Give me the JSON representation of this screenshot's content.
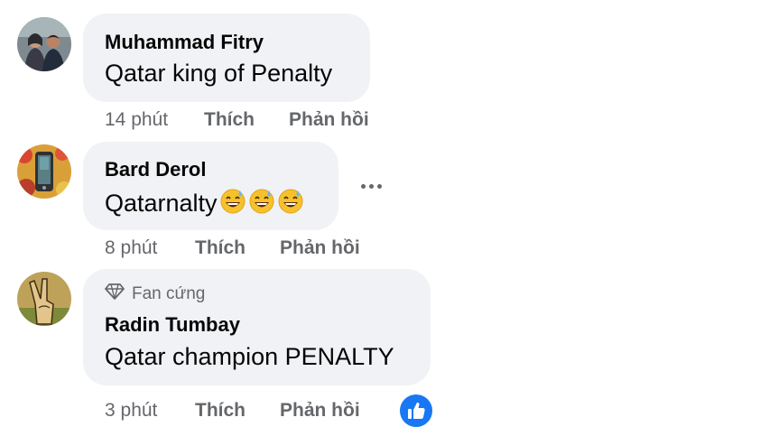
{
  "colors": {
    "bubble": "#f0f2f5",
    "meta": "#65676b",
    "like_blue": "#1877f2"
  },
  "comments": [
    {
      "author": "Muhammad Fitry",
      "text": "Qatar king of Penalty",
      "time": "14 phút",
      "like_label": "Thích",
      "reply_label": "Phản hồi"
    },
    {
      "author": "Bard Derol",
      "text": "Qatarnalty",
      "emojis": [
        "grinning-sweat-emoji",
        "grinning-sweat-emoji",
        "grinning-sweat-emoji"
      ],
      "time": "8 phút",
      "like_label": "Thích",
      "reply_label": "Phản hồi",
      "more_icon": "more-dots-icon"
    },
    {
      "badge": "Fan cứng",
      "badge_icon": "diamond-icon",
      "author": "Radin Tumbay",
      "text": "Qatar champion PENALTY",
      "time": "3 phút",
      "like_label": "Thích",
      "reply_label": "Phản hồi",
      "reaction_icon": "like-thumb-icon"
    }
  ]
}
